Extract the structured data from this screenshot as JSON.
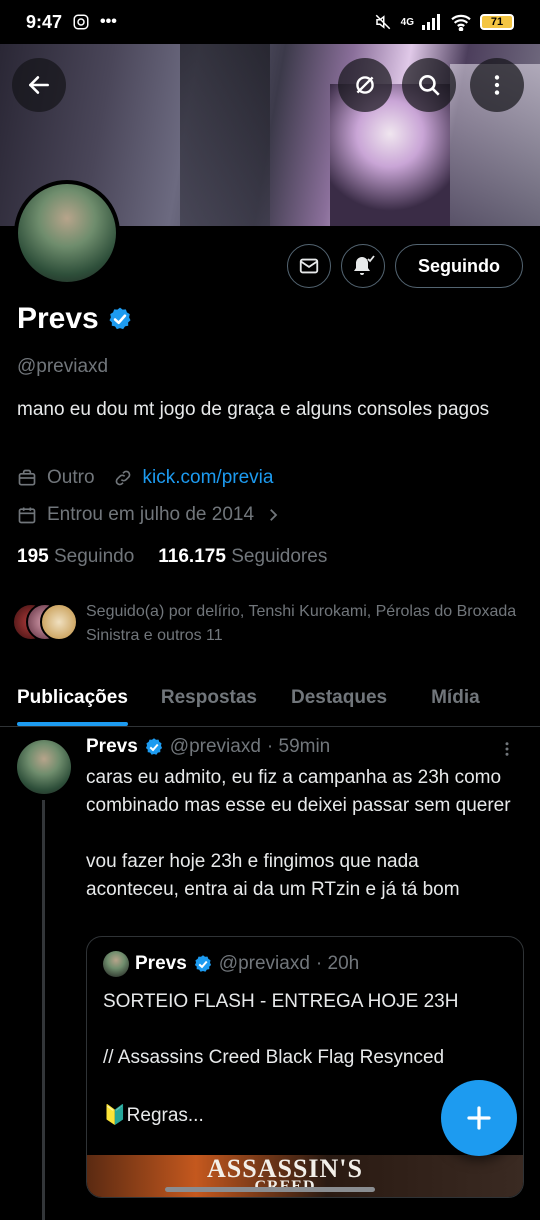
{
  "status_bar": {
    "time": "9:47",
    "network": "4G",
    "battery": "71"
  },
  "profile": {
    "name": "Prevs",
    "handle": "@previaxd",
    "bio": "mano eu dou mt jogo de graça e alguns consoles pagos",
    "category": "Outro",
    "website": "kick.com/previa",
    "joined": "Entrou em julho de 2014",
    "following_count": "195",
    "following_label": "Seguindo",
    "followers_count": "116.175",
    "followers_label": "Seguidores",
    "followed_by": "Seguido(a) por delírio, Tenshi Kurokami, Pérolas do Broxada Sinistra e outros 11",
    "follow_button": "Seguindo"
  },
  "tabs": [
    {
      "label": "Publicações",
      "active": true
    },
    {
      "label": "Respostas",
      "active": false
    },
    {
      "label": "Destaques",
      "active": false
    },
    {
      "label": "Mídia",
      "active": false
    }
  ],
  "tweet": {
    "name": "Prevs",
    "handle": "@previaxd",
    "time": "· 59min",
    "text": "caras eu admito, eu fiz a campanha as 23h como combinado mas esse eu deixei passar sem querer\n\nvou fazer hoje 23h e fingimos que nada aconteceu, entra ai da um RTzin e já tá bom",
    "quote": {
      "name": "Prevs",
      "handle": "@previaxd",
      "time": "· 20h",
      "line1": "SORTEIO FLASH - ENTREGA HOJE 23H",
      "line2": "// Assassins Creed Black Flag Resynced",
      "line3": "🔰Regras...",
      "image_text_1": "ASSASSIN'S",
      "image_text_2": "CREED"
    }
  },
  "fab_label": "+",
  "colors": {
    "accent": "#1d9bf0",
    "background": "#000000",
    "muted": "#71767b"
  }
}
